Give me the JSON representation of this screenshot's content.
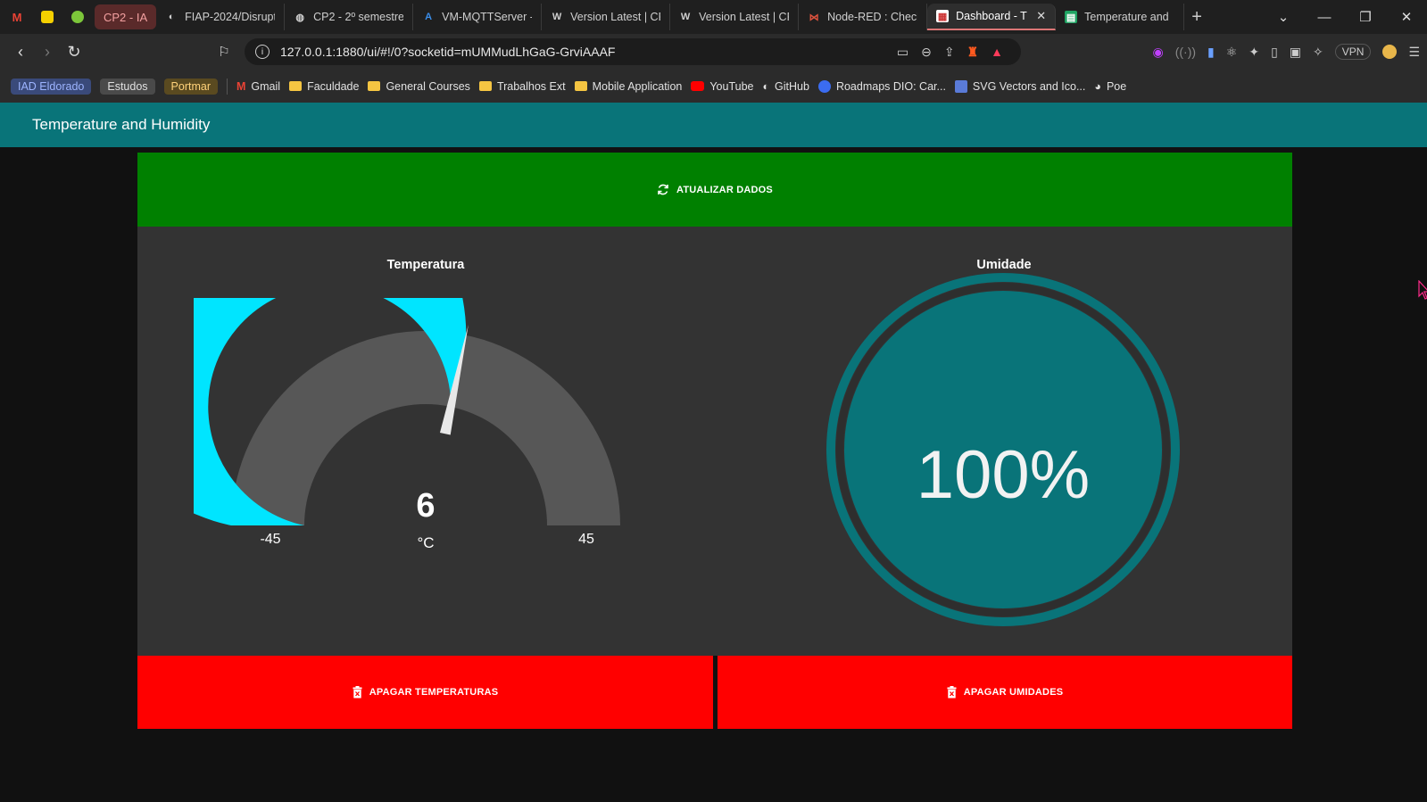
{
  "browser": {
    "pinned_tabs": [
      "gmail-icon",
      "tab-icon-yellow",
      "tab-icon-green"
    ],
    "tab_group": "CP2 - IA",
    "tabs": [
      {
        "title": "FIAP-2024/Disrupt",
        "icon": "github-icon"
      },
      {
        "title": "CP2 - 2º semestre",
        "icon": "globe-icon"
      },
      {
        "title": "VM-MQTTServer -",
        "icon": "azure-icon"
      },
      {
        "title": "Version Latest | CP",
        "icon": "wokwi-icon"
      },
      {
        "title": "Version Latest | CP",
        "icon": "wokwi-icon"
      },
      {
        "title": "Node-RED : Check",
        "icon": "nodered-icon"
      },
      {
        "title": "Dashboard - T",
        "icon": "dashboard-icon",
        "active": true
      },
      {
        "title": "Temperature and",
        "icon": "sheets-icon"
      }
    ],
    "url": "127.0.0.1:1880/ui/#!/0?socketid=mUMMudLhGaG-GrviAAAF",
    "vpn_label": "VPN",
    "bookmark_groups": [
      {
        "label": "IAD Eldorado",
        "color": "#3a4a7a",
        "text_color": "#9db4ff"
      },
      {
        "label": "Estudos",
        "color": "#4a4a4a",
        "text_color": "#e0e0e0"
      },
      {
        "label": "Portmar",
        "color": "#5a4a20",
        "text_color": "#ffd27a"
      }
    ],
    "bookmarks": [
      {
        "label": "Gmail",
        "icon": "gmail-icon"
      },
      {
        "label": "Faculdade",
        "icon": "folder-icon"
      },
      {
        "label": "General Courses",
        "icon": "folder-icon"
      },
      {
        "label": "Trabalhos Ext",
        "icon": "folder-icon"
      },
      {
        "label": "Mobile Application",
        "icon": "folder-icon"
      },
      {
        "label": "YouTube",
        "icon": "youtube-icon"
      },
      {
        "label": "GitHub",
        "icon": "github-icon"
      },
      {
        "label": "Roadmaps DIO: Car...",
        "icon": "dio-icon"
      },
      {
        "label": "SVG Vectors and Ico...",
        "icon": "svgrepo-icon"
      },
      {
        "label": "Poe",
        "icon": "poe-icon"
      }
    ]
  },
  "dashboard": {
    "title": "Temperature and Humidity",
    "refresh_label": "ATUALIZAR DADOS",
    "delete_temp_label": "APAGAR TEMPERATURAS",
    "delete_hum_label": "APAGAR UMIDADES",
    "temperature": {
      "title": "Temperatura",
      "value": "6",
      "numeric_value": 6,
      "unit": "°C",
      "min": -45,
      "max": 45,
      "min_label": "-45",
      "max_label": "45",
      "color_fill": "#00e5ff",
      "color_track": "#575757"
    },
    "humidity": {
      "title": "Umidade",
      "value": "100%",
      "numeric_value": 100,
      "color": "#097479"
    }
  },
  "colors": {
    "header": "#097479",
    "refresh_button": "#008000",
    "delete_button": "#ff0000",
    "panel": "#333333",
    "background": "#111111"
  }
}
